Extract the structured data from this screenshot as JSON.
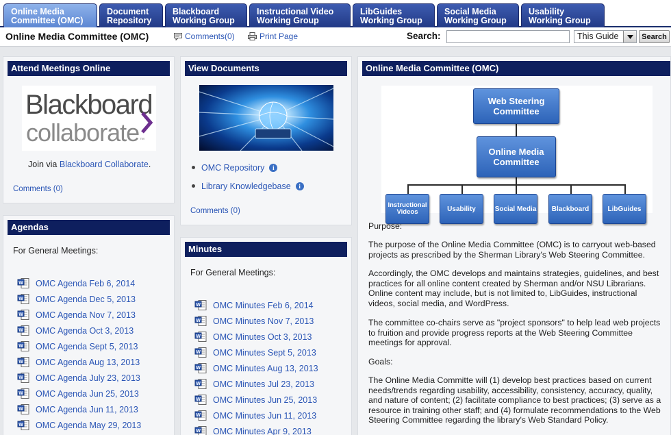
{
  "tabs": [
    {
      "line1": "Online Media",
      "line2": "Committee (OMC)",
      "active": true
    },
    {
      "line1": "Document",
      "line2": "Repository"
    },
    {
      "line1": "Blackboard",
      "line2": "Working Group"
    },
    {
      "line1": "Instructional Video",
      "line2": "Working Group"
    },
    {
      "line1": "LibGuides",
      "line2": "Working Group"
    },
    {
      "line1": "Social Media",
      "line2": "Working Group"
    },
    {
      "line1": "Usability",
      "line2": "Working Group"
    }
  ],
  "header": {
    "title": "Online Media Committee (OMC)",
    "comments_link": "Comments(0)",
    "print_link": "Print Page",
    "search_label": "Search:",
    "search_value": "",
    "scope": "This Guide",
    "search_button": "Search"
  },
  "attend": {
    "title": "Attend Meetings Online",
    "logo_line1": "Blackboard",
    "logo_line2": "collaborate",
    "logo_tm": "™",
    "join_prefix": "Join via ",
    "join_link": "Blackboard Collaborate",
    "join_suffix": ".",
    "comments": "Comments (0)"
  },
  "agendas": {
    "title": "Agendas",
    "intro": "For General Meetings:",
    "items": [
      "OMC Agenda Feb 6, 2014",
      "OMC Agenda Dec 5, 2013",
      "OMC Agenda Nov 7, 2013",
      "OMC Agenda Oct 3, 2013",
      "OMC Agenda Sept 5, 2013",
      "OMC Agenda Aug 13, 2013",
      "OMC Agenda July 23, 2013",
      "OMC Agenda Jun 25, 2013",
      "OMC Agenda Jun 11, 2013",
      "OMC Agenda May 29, 2013"
    ]
  },
  "documents": {
    "title": "View Documents",
    "links": [
      "OMC Repository",
      "Library Knowledgebase"
    ],
    "comments": "Comments (0)"
  },
  "minutes": {
    "title": "Minutes",
    "intro": "For General Meetings:",
    "items": [
      "OMC Minutes Feb 6, 2014",
      "OMC Minutes Nov 7, 2013",
      "OMC Minutes Oct 3, 2013",
      "OMC Minutes Sept 5, 2013",
      "OMC Minutes Aug 13, 2013",
      "OMC Minutes Jul 23, 2013",
      "OMC Minutes Jun 25, 2013",
      "OMC Minutes Jun 11, 2013",
      "OMC Minutes Apr 9, 2013"
    ]
  },
  "omc": {
    "title": "Online Media Committee (OMC)",
    "org": {
      "top": "Web Steering Committee",
      "middle": "Online Media Committee",
      "children": [
        "Instructional Videos",
        "Usability",
        "Social Media",
        "Blackboard",
        "LibGuides"
      ]
    },
    "purpose_heading": "Purpose:",
    "p1": "The purpose of the Online Media Committee (OMC) is to carryout web-based projects as prescribed by the Sherman Library's Web Steering Committee.",
    "p2": "Accordingly, the OMC develops and maintains strategies, guidelines, and best practices for all online content created by Sherman and/or NSU Librarians. Online content may include, but is not limited to, LibGuides, instructional videos, social media, and WordPress.",
    "p3": "The committee co-chairs serve as \"project sponsors\" to help lead web projects to fruition and provide progress reports at the Web Steering Committee meetings for approval.",
    "goals_heading": "Goals:",
    "p4": "The Online Media Committe will (1) develop best practices based on current needs/trends regarding usability, accessibility, consistency, accuracy, quality, and nature of content; (2) facilitate compliance to best practices; (3) serve as a resource in training other staff; and (4) formulate recommendations to the Web Steering Committee regarding the library's Web Standard Policy."
  }
}
